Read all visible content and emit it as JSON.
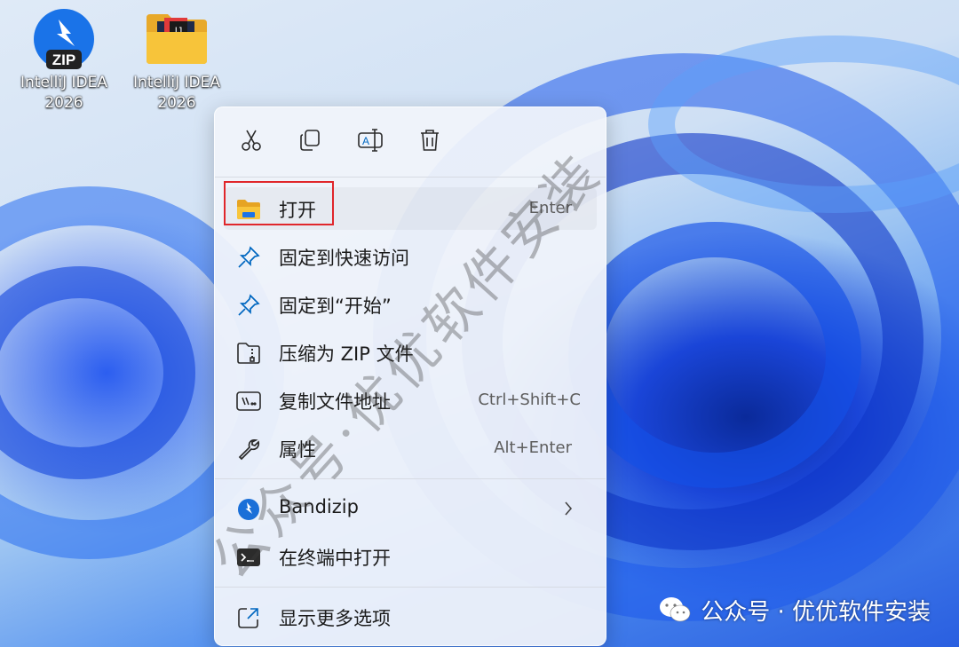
{
  "desktop": {
    "icons": [
      {
        "label_line1": "IntelliJ IDEA",
        "label_line2": "2026",
        "icon": "bandizip-zip-icon",
        "badge": "ZIP"
      },
      {
        "label_line1": "IntelliJ IDEA",
        "label_line2": "2026",
        "icon": "folder-icon",
        "badge": "IJ"
      }
    ]
  },
  "toolbar": {
    "cut_icon": "cut-icon",
    "copy_icon": "copy-icon",
    "rename_icon": "rename-icon",
    "rename_glyph": "A",
    "delete_icon": "delete-icon"
  },
  "menu": {
    "items": [
      {
        "label": "打开",
        "shortcut": "Enter",
        "icon": "folder-open-icon"
      },
      {
        "label": "固定到快速访问",
        "shortcut": "",
        "icon": "pin-icon"
      },
      {
        "label": "固定到“开始”",
        "shortcut": "",
        "icon": "pin-start-icon"
      },
      {
        "label": "压缩为 ZIP 文件",
        "shortcut": "",
        "icon": "zip-archive-icon"
      },
      {
        "label": "复制文件地址",
        "shortcut": "Ctrl+Shift+C",
        "icon": "copy-path-icon"
      },
      {
        "label": "属性",
        "shortcut": "Alt+Enter",
        "icon": "wrench-icon"
      },
      {
        "label": "Bandizip",
        "shortcut": "",
        "icon": "bandizip-icon",
        "submenu_icon": "chevron-right-icon"
      },
      {
        "label": "在终端中打开",
        "shortcut": "",
        "icon": "terminal-icon"
      },
      {
        "label": "显示更多选项",
        "shortcut": "",
        "icon": "show-more-icon"
      }
    ]
  },
  "watermark": {
    "diagonal": "公众号·优优软件安装",
    "corner": "公众号 · 优优软件安装",
    "corner_icon": "wechat-icon"
  },
  "colors": {
    "highlight_border": "#e0262b",
    "accent": "#0067c0",
    "folder_yellow": "#f7c43a"
  }
}
